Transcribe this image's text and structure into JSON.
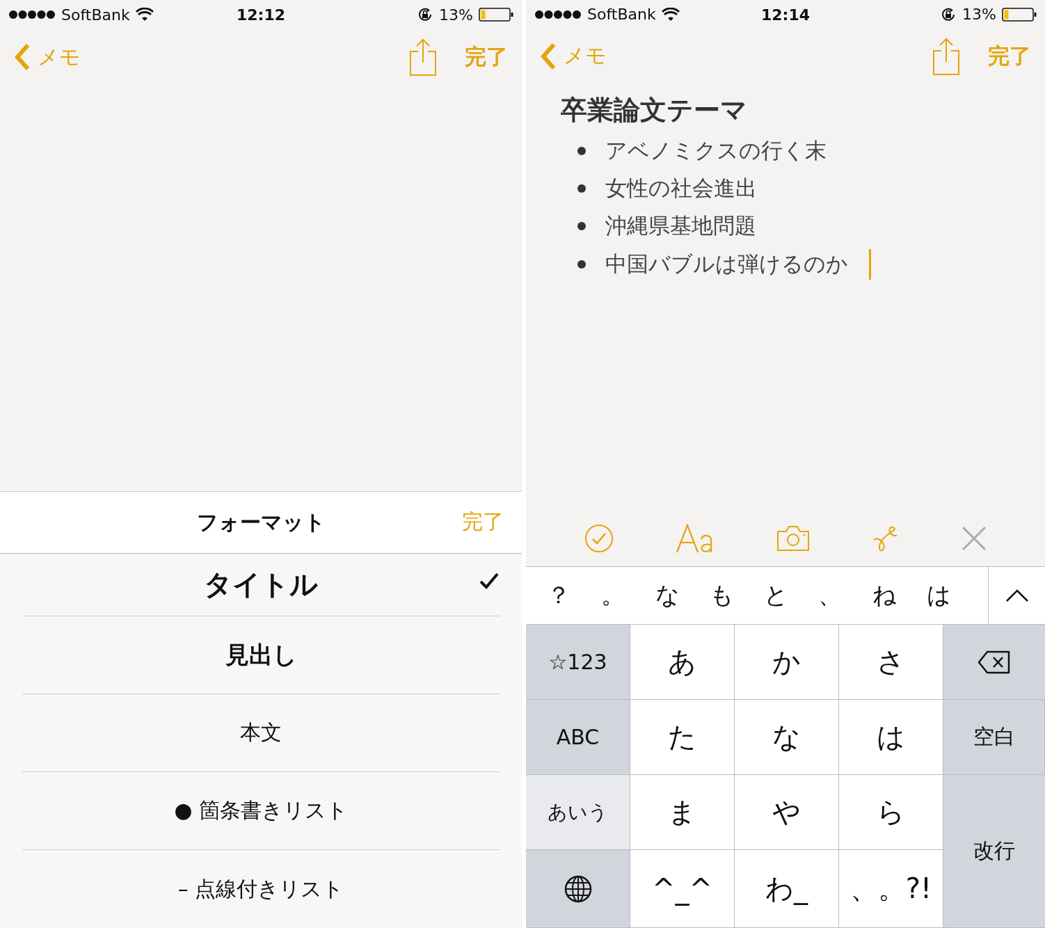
{
  "left_screen": {
    "status_bar": {
      "carrier": "SoftBank",
      "time": "12:12",
      "battery": "13%"
    },
    "nav_bar": {
      "back": "メモ",
      "done": "完了"
    },
    "format_sheet": {
      "title": "フォーマット",
      "done": "完了",
      "options": [
        {
          "label": "タイトル",
          "kind": "title",
          "selected": true
        },
        {
          "label": "見出し",
          "kind": "heading",
          "selected": false
        },
        {
          "label": "本文",
          "kind": "body",
          "selected": false
        },
        {
          "label": "● 箇条書きリスト",
          "kind": "body",
          "selected": false
        },
        {
          "label": "– 点線付きリスト",
          "kind": "body",
          "selected": false
        }
      ]
    }
  },
  "right_screen": {
    "status_bar": {
      "carrier": "SoftBank",
      "time": "12:14",
      "battery": "13%"
    },
    "nav_bar": {
      "back": "メモ",
      "done": "完了"
    },
    "note": {
      "title": "卒業論文テーマ",
      "items": [
        "アベノミクスの行く末",
        "女性の社会進出",
        "沖縄県基地問題",
        "中国バブルは弾けるのか"
      ]
    },
    "candidates": [
      "？",
      "。",
      "な",
      "も",
      "と",
      "、",
      "ね",
      "は"
    ],
    "keys": [
      {
        "label": "☆123",
        "kind": "function"
      },
      {
        "label": "あ",
        "kind": "letter"
      },
      {
        "label": "か",
        "kind": "letter"
      },
      {
        "label": "さ",
        "kind": "letter"
      },
      {
        "kind": "backspace"
      },
      {
        "label": "ABC",
        "kind": "function"
      },
      {
        "label": "た",
        "kind": "letter"
      },
      {
        "label": "な",
        "kind": "letter"
      },
      {
        "label": "は",
        "kind": "letter"
      },
      {
        "label": "空白",
        "kind": "function"
      },
      {
        "label": "あいう",
        "kind": "light"
      },
      {
        "label": "ま",
        "kind": "letter"
      },
      {
        "label": "や",
        "kind": "letter"
      },
      {
        "label": "ら",
        "kind": "letter"
      },
      {
        "label": "改行",
        "kind": "return"
      },
      {
        "kind": "globe"
      },
      {
        "label": "^_^",
        "kind": "letter"
      },
      {
        "label": "わ_",
        "kind": "letter"
      },
      {
        "label": "、。?!",
        "kind": "letter"
      }
    ]
  }
}
